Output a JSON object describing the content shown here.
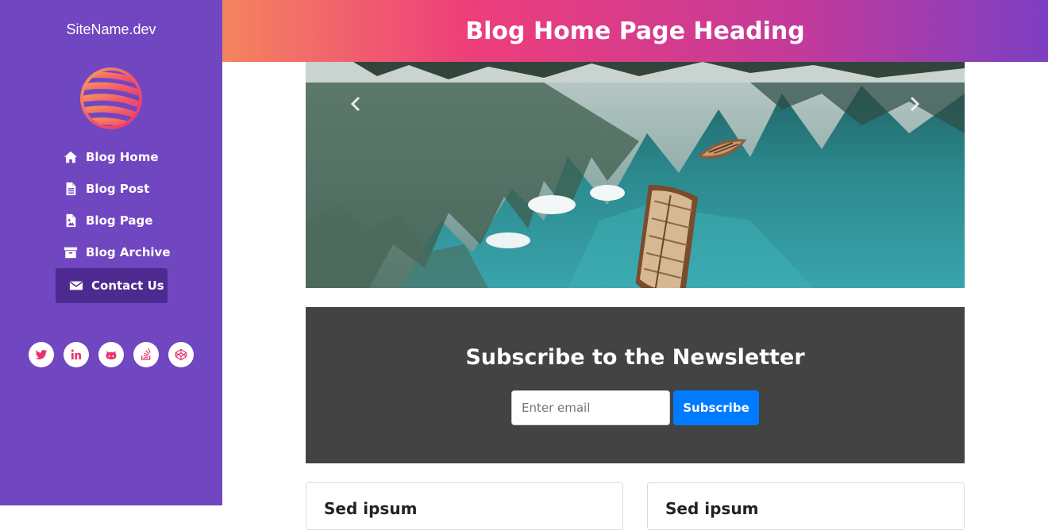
{
  "sidebar": {
    "site_name": "SiteName.dev",
    "nav": [
      {
        "label": "Blog Home",
        "icon": "home-icon"
      },
      {
        "label": "Blog Post",
        "icon": "file-text-icon"
      },
      {
        "label": "Blog Page",
        "icon": "file-image-icon"
      },
      {
        "label": "Blog Archive",
        "icon": "archive-icon"
      },
      {
        "label": "Contact Us",
        "icon": "envelope-icon",
        "active": true
      }
    ],
    "social": [
      "twitter-icon",
      "linkedin-icon",
      "github-icon",
      "stackoverflow-icon",
      "codepen-icon"
    ]
  },
  "header": {
    "title": "Blog Home Page Heading"
  },
  "carousel": {
    "prev_icon": "chevron-left-icon",
    "next_icon": "chevron-right-icon"
  },
  "newsletter": {
    "title": "Subscribe to the Newsletter",
    "email_placeholder": "Enter email",
    "button_label": "Subscribe"
  },
  "cards": [
    {
      "title": "Sed ipsum"
    },
    {
      "title": "Sed ipsum"
    }
  ],
  "colors": {
    "sidebar_bg": "#7146c1",
    "active_nav_bg": "#4c2a8f",
    "newsletter_bg": "#434343",
    "button_bg": "#007bff",
    "social_icon": "#e8336f"
  }
}
